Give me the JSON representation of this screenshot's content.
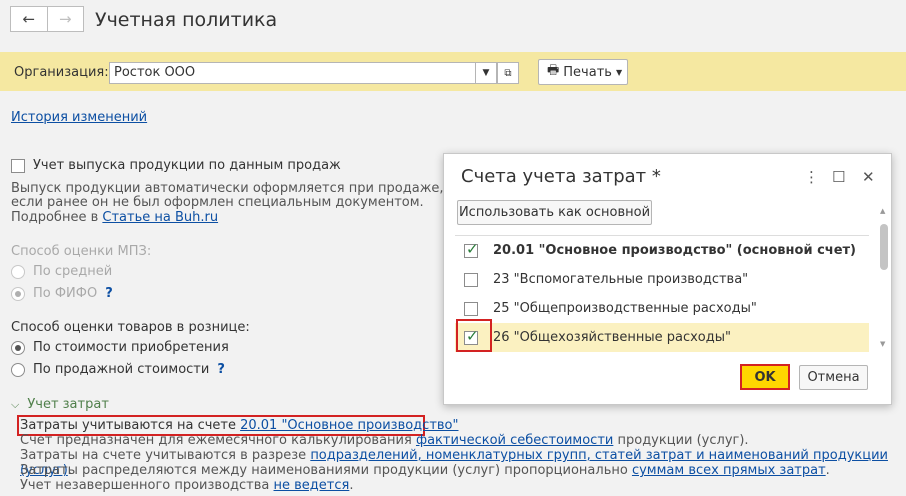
{
  "header": {
    "title": "Учетная политика",
    "back_icon": "←",
    "forward_icon": "→"
  },
  "org": {
    "label": "Организация:",
    "value": "Росток ООО",
    "print_label": "Печать"
  },
  "history_link": "История изменений",
  "production": {
    "checkbox_label": "Учет выпуска продукции по данным продаж",
    "desc1": "Выпуск продукции автоматически оформляется при продаже,",
    "desc2": "если ранее он не был оформлен специальным документом.",
    "desc3_prefix": "Подробнее в ",
    "desc3_link": "Статье на Buh.ru"
  },
  "mpz": {
    "label": "Способ оценки МПЗ:",
    "opt_avg": "По средней",
    "opt_fifo": "По ФИФО",
    "help": "?"
  },
  "retail": {
    "label": "Способ оценки товаров в рознице:",
    "opt_cost": "По стоимости приобретения",
    "opt_sale": "По продажной стоимости",
    "help": "?"
  },
  "costs": {
    "section": "Учет затрат",
    "line1_prefix": "Затраты учитываются на счете ",
    "line1_link": "20.01 \"Основное производство\"",
    "line2_prefix": "Счет предназначен для ежемесячного калькулирования ",
    "line2_link": "фактической себестоимости",
    "line2_suffix": " продукции (услуг).",
    "line3_prefix": "Затраты на счете учитываются в разрезе ",
    "line3_link": "подразделений, номенклатурных групп, статей затрат и наименований продукции (услуг)",
    "line3_suffix": ".",
    "line4_prefix": "Затраты распределяются между наименованиями продукции (услуг) пропорционально ",
    "line4_link": "суммам всех прямых затрат",
    "line4_suffix": ".",
    "line5_prefix": "Учет незавершенного производства ",
    "line5_link": "не ведется",
    "line5_suffix": "."
  },
  "dialog": {
    "title": "Счета учета затрат *",
    "use_main_button": "Использовать как основной",
    "accounts": [
      {
        "label": "20.01 \"Основное производство\" (основной счет)",
        "checked": true,
        "bold": true
      },
      {
        "label": "23 \"Вспомогательные производства\"",
        "checked": false,
        "bold": false
      },
      {
        "label": "25 \"Общепроизводственные расходы\"",
        "checked": false,
        "bold": false
      },
      {
        "label": "26 \"Общехозяйственные расходы\"",
        "checked": true,
        "bold": false
      }
    ],
    "ok": "OK",
    "cancel": "Отмена"
  },
  "colors": {
    "accent_bar": "#f5e8a1",
    "link": "#0c4fa3",
    "highlight": "#d32222",
    "ok": "#ffd700",
    "check": "#2a7d3a"
  }
}
